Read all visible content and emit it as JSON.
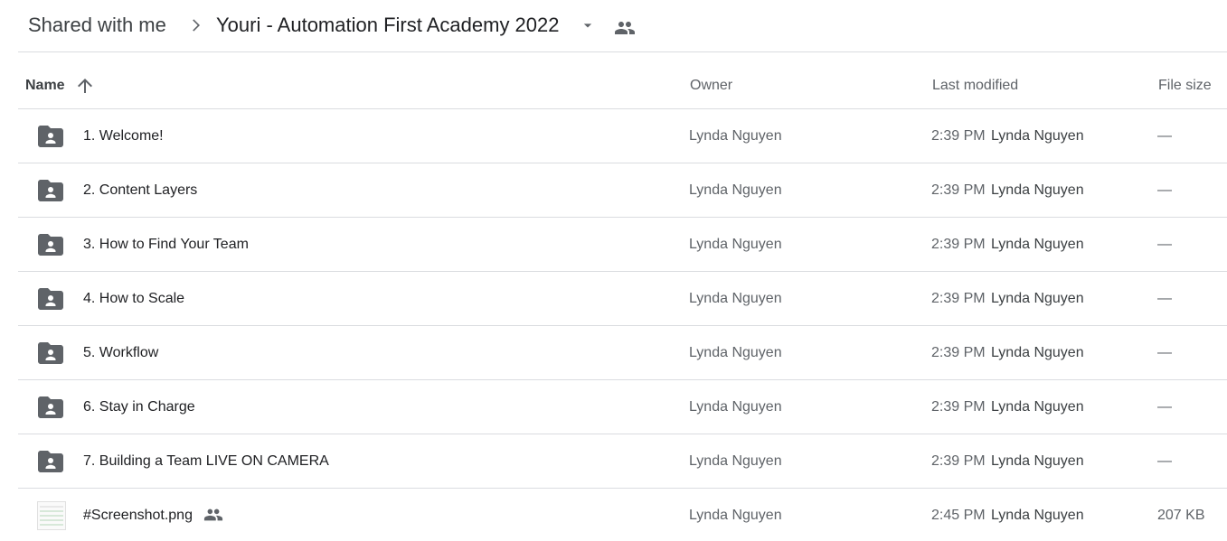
{
  "breadcrumb": {
    "root": "Shared with me",
    "current": "Youri - Automation First Academy 2022",
    "separator_icon": "chevron-right-icon",
    "dropdown_icon": "arrow-drop-down-icon",
    "shared_icon": "people-icon"
  },
  "columns": {
    "name": "Name",
    "sort_icon": "arrow-up-icon",
    "owner": "Owner",
    "last_modified": "Last modified",
    "file_size": "File size"
  },
  "colors": {
    "icon": "#5f6368",
    "divider": "#dadce0",
    "text": "#202124"
  },
  "files": [
    {
      "name": "1. Welcome!",
      "type": "shared-folder",
      "owner": "Lynda Nguyen",
      "time": "2:39 PM",
      "modified_by": "Lynda Nguyen",
      "size": "—"
    },
    {
      "name": "2. Content Layers",
      "type": "shared-folder",
      "owner": "Lynda Nguyen",
      "time": "2:39 PM",
      "modified_by": "Lynda Nguyen",
      "size": "—"
    },
    {
      "name": "3. How to Find Your Team",
      "type": "shared-folder",
      "owner": "Lynda Nguyen",
      "time": "2:39 PM",
      "modified_by": "Lynda Nguyen",
      "size": "—"
    },
    {
      "name": "4. How to Scale",
      "type": "shared-folder",
      "owner": "Lynda Nguyen",
      "time": "2:39 PM",
      "modified_by": "Lynda Nguyen",
      "size": "—"
    },
    {
      "name": "5. Workflow",
      "type": "shared-folder",
      "owner": "Lynda Nguyen",
      "time": "2:39 PM",
      "modified_by": "Lynda Nguyen",
      "size": "—"
    },
    {
      "name": "6. Stay in Charge",
      "type": "shared-folder",
      "owner": "Lynda Nguyen",
      "time": "2:39 PM",
      "modified_by": "Lynda Nguyen",
      "size": "—"
    },
    {
      "name": "7. Building a Team LIVE ON CAMERA",
      "type": "shared-folder",
      "owner": "Lynda Nguyen",
      "time": "2:39 PM",
      "modified_by": "Lynda Nguyen",
      "size": "—"
    },
    {
      "name": "#Screenshot.png",
      "type": "image",
      "owner": "Lynda Nguyen",
      "time": "2:45 PM",
      "modified_by": "Lynda Nguyen",
      "size": "207 KB",
      "shared": true
    }
  ]
}
